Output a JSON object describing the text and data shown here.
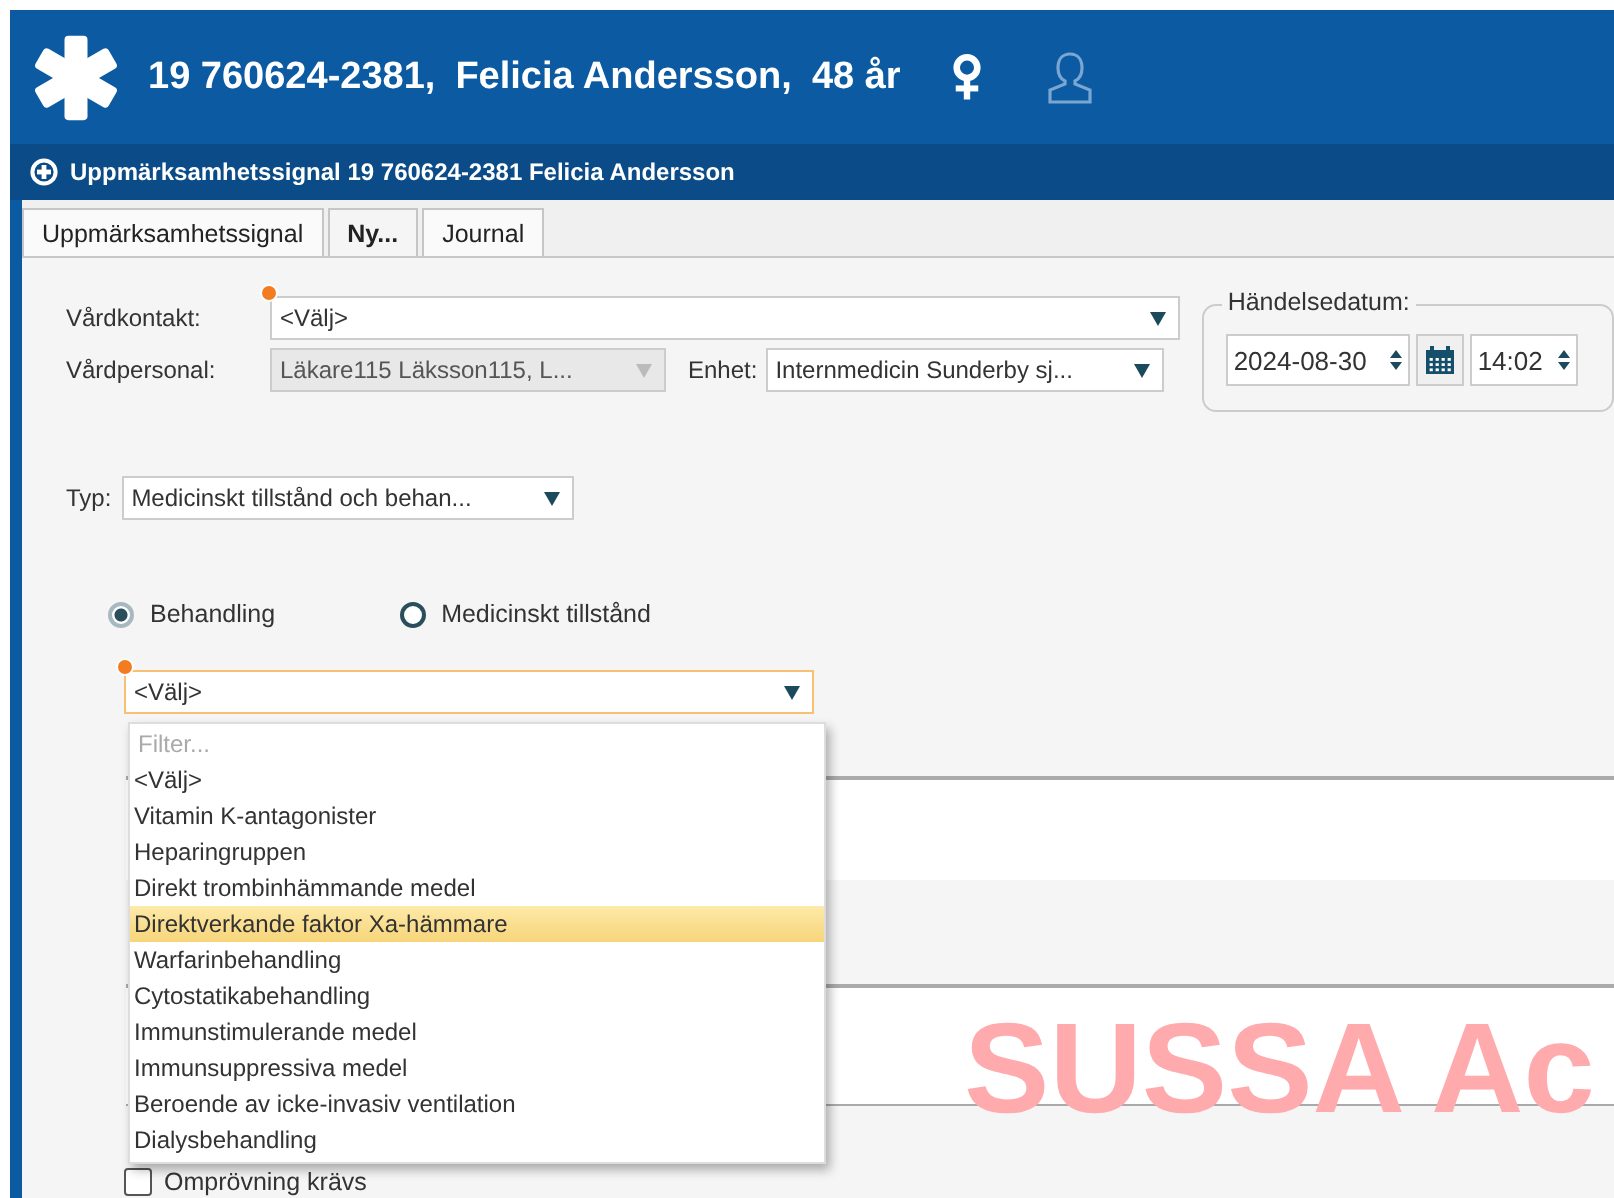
{
  "header": {
    "personal_number": "19 760624-2381,",
    "name": "Felicia Andersson,",
    "age": "48 år"
  },
  "window": {
    "title": "Uppmärksamhetssignal 19 760624-2381 Felicia Andersson"
  },
  "tabs": [
    {
      "label": "Uppmärksamhetssignal",
      "selected": false
    },
    {
      "label": "Ny...",
      "selected": true
    },
    {
      "label": "Journal",
      "selected": false
    }
  ],
  "vardkontakt": {
    "label": "Vårdkontakt:",
    "value": "<Välj>",
    "required": true
  },
  "vardpersonal": {
    "label": "Vårdpersonal:",
    "value": "Läkare115 Läksson115, L...",
    "disabled": true
  },
  "enhet": {
    "label": "Enhet:",
    "value": "Internmedicin Sunderby sj..."
  },
  "event_date": {
    "legend": "Händelsedatum:",
    "date": "2024-08-30",
    "time": "14:02"
  },
  "typ": {
    "label": "Typ:",
    "value": "Medicinskt tillstånd och behan..."
  },
  "radios": [
    {
      "label": "Behandling",
      "selected": true
    },
    {
      "label": "Medicinskt tillstånd",
      "selected": false
    }
  ],
  "treatment_select": {
    "value": "<Välj>",
    "required": true,
    "expanded": true
  },
  "dropdown": {
    "filter_placeholder": "Filter...",
    "options": [
      {
        "label": "<Välj>",
        "selected": false
      },
      {
        "label": "Vitamin K-antagonister",
        "selected": false
      },
      {
        "label": "Heparingruppen",
        "selected": false
      },
      {
        "label": "Direkt trombinhämmande medel",
        "selected": false
      },
      {
        "label": "Direktverkande faktor Xa-hämmare",
        "selected": true
      },
      {
        "label": "Warfarinbehandling",
        "selected": false
      },
      {
        "label": "Cytostatikabehandling",
        "selected": false
      },
      {
        "label": "Immunstimulerande medel",
        "selected": false
      },
      {
        "label": "Immunsuppressiva medel",
        "selected": false
      },
      {
        "label": "Beroende av icke-invasiv ventilation",
        "selected": false
      },
      {
        "label": "Dialysbehandling",
        "selected": false
      }
    ]
  },
  "review_checkbox": {
    "label": "Omprövning krävs",
    "checked": false
  },
  "environment_label": "SUSSA Ac"
}
